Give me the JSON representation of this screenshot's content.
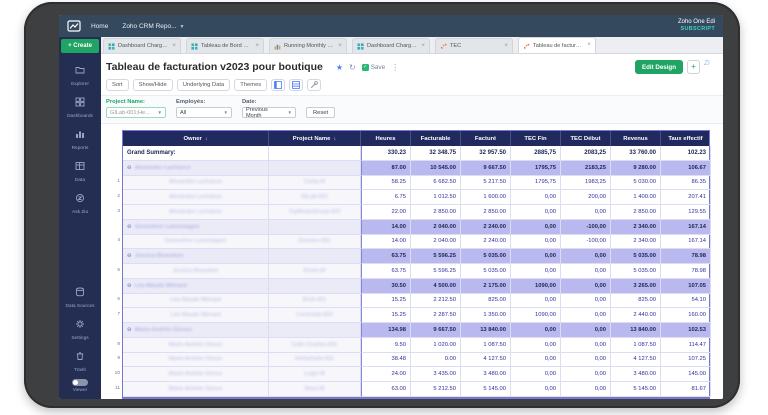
{
  "topbar": {
    "home_label": "Home",
    "workspace_label": "Zoho CRM Repo...",
    "right_line1": "Zoho One Edi",
    "right_line2": "SUBSCRIPT"
  },
  "tabbar": {
    "create_label": "+ Create",
    "close_glyph": "×",
    "tabs": [
      {
        "label": "Dashboard Chargé d...",
        "icon": "dashboard",
        "active": false
      },
      {
        "label": "Tableau de Bord Emp...",
        "icon": "dashboard",
        "active": false
      },
      {
        "label": "Running Monthly Eff...",
        "icon": "bar-chart",
        "active": false
      },
      {
        "label": "Dashboard Chargé w...",
        "icon": "dashboard",
        "active": false
      },
      {
        "label": "TEC",
        "icon": "scatter",
        "active": false
      },
      {
        "label": "Tableau de facturatio...",
        "icon": "scatter",
        "active": true
      }
    ]
  },
  "report": {
    "title": "Tableau de facturation v2023 pour boutique",
    "save_label": "Save",
    "edit_design_label": "Edit Design",
    "add_label": "+"
  },
  "toolbar": {
    "buttons": [
      "Sort",
      "Show/Hide",
      "Underlying Data",
      "Themes"
    ],
    "icon_buttons": [
      "freeze-columns-icon",
      "table-view-icon",
      "tools-icon"
    ]
  },
  "filters": {
    "project": {
      "label": "Project Name:",
      "value": "GILab-001;He..."
    },
    "employee": {
      "label": "Employés:",
      "value": "All"
    },
    "date": {
      "label": "Date:",
      "value": "Previous Month"
    },
    "reset_label": "Reset"
  },
  "sidebar": {
    "items": [
      {
        "label": "Explorer",
        "icon": "explorer-icon"
      },
      {
        "label": "Dashboards",
        "icon": "dashboards-icon"
      },
      {
        "label": "Reports",
        "icon": "reports-icon"
      },
      {
        "label": "Data",
        "icon": "data-icon"
      },
      {
        "label": "Ask Zia",
        "icon": "ask-zia-icon"
      }
    ],
    "bottom_items": [
      {
        "label": "Data Sources",
        "icon": "data-sources-icon"
      },
      {
        "label": "Settings",
        "icon": "settings-icon"
      },
      {
        "label": "Trash",
        "icon": "trash-icon"
      }
    ],
    "viewer_label": "Viewer"
  },
  "table": {
    "headers": [
      "Owner",
      "Project Name",
      "Heures",
      "Facturable",
      "Facturé",
      "TEC Fin",
      "TEC Début",
      "Revenus",
      "Taux effectif"
    ],
    "sorted_columns": [
      0,
      1
    ],
    "grand_summary": {
      "label": "Grand Summary:",
      "values": [
        "330.23",
        "32 348.75",
        "32 957.50",
        "2885,75",
        "2083,25",
        "33 760.00",
        "102.23"
      ]
    },
    "rows": [
      {
        "type": "group",
        "owner": "Alexandre Lachance",
        "project": "",
        "values": [
          "87.00",
          "10 545.00",
          "9 667.50",
          "1795,75",
          "2183,25",
          "9 280.00",
          "106.67"
        ]
      },
      {
        "type": "data",
        "num": "1",
        "owner": "Alexandre Lachance",
        "project": "Civlia-M",
        "values": [
          "58.25",
          "6 682.50",
          "5 217.50",
          "1795,75",
          "1983,25",
          "5 030.00",
          "86.35"
        ]
      },
      {
        "type": "data",
        "num": "2",
        "owner": "Alexandre Lachance",
        "project": "GiLab-001",
        "values": [
          "6.75",
          "1 012.50",
          "1 600.00",
          "0,00",
          "200,00",
          "1 400.00",
          "207.41"
        ]
      },
      {
        "type": "data",
        "num": "3",
        "owner": "Alexandre Lachance",
        "project": "TopRestoGroup-002",
        "values": [
          "22.00",
          "2 850.00",
          "2 850.00",
          "0,00",
          "0,00",
          "2 850.00",
          "129.55"
        ]
      },
      {
        "type": "group",
        "owner": "Geneviève Lamontagne",
        "project": "",
        "values": [
          "14.00",
          "2 040.00",
          "2 240.00",
          "0,00",
          "-100,00",
          "2 340.00",
          "167.14"
        ]
      },
      {
        "type": "data",
        "num": "4",
        "owner": "Geneviève Lamontagne",
        "project": "Dosiven-001",
        "values": [
          "14.00",
          "2 040.00",
          "2 240.00",
          "0,00",
          "-100,00",
          "2 340.00",
          "167.14"
        ]
      },
      {
        "type": "group",
        "owner": "Jessica Beaudoin",
        "project": "",
        "values": [
          "63.75",
          "5 596.25",
          "5 035.00",
          "0,00",
          "0,00",
          "5 035.00",
          "78.98"
        ]
      },
      {
        "type": "data",
        "num": "5",
        "owner": "Jessica Beaudoin",
        "project": "Resto-M",
        "values": [
          "63.75",
          "5 596.25",
          "5 035.00",
          "0,00",
          "0,00",
          "5 035.00",
          "78.98"
        ]
      },
      {
        "type": "group",
        "owner": "Léa Maude Ménard",
        "project": "",
        "values": [
          "30.50",
          "4 500.00",
          "2 175.00",
          "1090,00",
          "0,00",
          "3 265.00",
          "107.05"
        ]
      },
      {
        "type": "data",
        "num": "6",
        "owner": "Léa Maude Ménard",
        "project": "BCA-001",
        "values": [
          "15.25",
          "2 212.50",
          "825.00",
          "0,00",
          "0,00",
          "825.00",
          "54.10"
        ]
      },
      {
        "type": "data",
        "num": "7",
        "owner": "Léa Maude Ménard",
        "project": "Controlab-002",
        "values": [
          "15.25",
          "2 287.50",
          "1 350.00",
          "1090,00",
          "0,00",
          "2 440.00",
          "160.00"
        ]
      },
      {
        "type": "group",
        "owner": "Marie-Andrée Giroux",
        "project": "",
        "values": [
          "134.98",
          "9 667.50",
          "13 840.00",
          "0,00",
          "0,00",
          "13 840.00",
          "102.53"
        ]
      },
      {
        "type": "data",
        "num": "8",
        "owner": "Marie-Andrée Giroux",
        "project": "Café-Charles-001",
        "values": [
          "9.50",
          "1 020.00",
          "1 087.50",
          "0,00",
          "0,00",
          "1 087.50",
          "114.47"
        ]
      },
      {
        "type": "data",
        "num": "9",
        "owner": "Marie-Andrée Giroux",
        "project": "HerbaSafe-001",
        "values": [
          "38.48",
          "0.00",
          "4 127.50",
          "0,00",
          "0,00",
          "4 127.50",
          "107.25"
        ]
      },
      {
        "type": "data",
        "num": "10",
        "owner": "Marie-Andrée Giroux",
        "project": "Logic-M",
        "values": [
          "24.00",
          "3 435.00",
          "3 480.00",
          "0,00",
          "0,00",
          "3 480.00",
          "145.00"
        ]
      },
      {
        "type": "data",
        "num": "11",
        "owner": "Marie-Andrée Giroux",
        "project": "Mars-M",
        "values": [
          "63.00",
          "5 212.50",
          "5 145.00",
          "0,00",
          "0,00",
          "5 145.00",
          "81.67"
        ]
      }
    ]
  },
  "colors": {
    "accent_green": "#1fa463",
    "teal": "#3fd0c0",
    "topbar_slate": "#35495e",
    "sidebar_navy": "#232e52",
    "table_header_navy": "#212a5e",
    "group_row_lavender": "#b9b9ef",
    "value_indigo": "#2e2e9e"
  }
}
